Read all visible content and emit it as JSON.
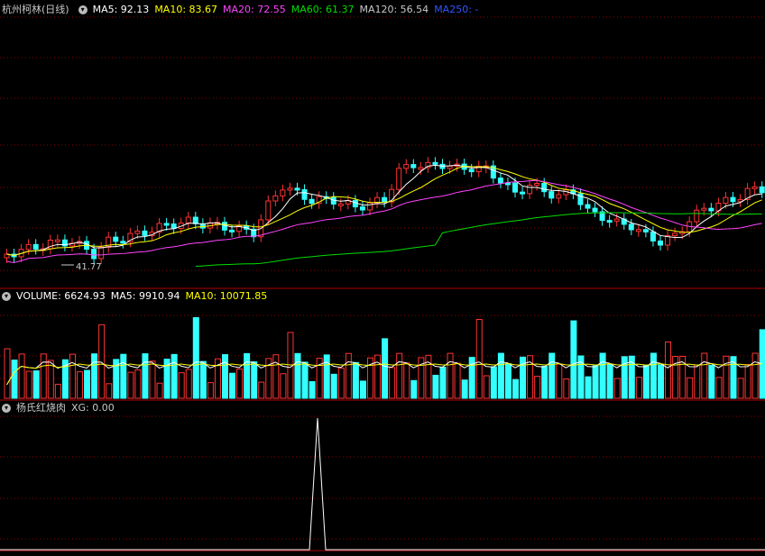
{
  "price_panel": {
    "title": "杭州柯林(日线)",
    "ma": [
      {
        "label": "MA5: 92.13",
        "color": "#ffffff"
      },
      {
        "label": "MA10: 83.67",
        "color": "#ffff00"
      },
      {
        "label": "MA20: 72.55",
        "color": "#ff44ff"
      },
      {
        "label": "MA60: 61.37",
        "color": "#00dd00"
      },
      {
        "label": "MA120: 56.54",
        "color": "#c8c8c8"
      },
      {
        "label": "MA250: -",
        "color": "#3355ff"
      }
    ],
    "low_marker": "41.77"
  },
  "volume_panel": {
    "items": [
      {
        "label": "VOLUME: 6624.93",
        "color": "#ffffff"
      },
      {
        "label": "MA5: 9910.94",
        "color": "#ffffff"
      },
      {
        "label": "MA10: 10071.85",
        "color": "#ffff00"
      }
    ]
  },
  "indicator_panel": {
    "title": "杨氏红烧肉",
    "xg": "XG: 0.00"
  },
  "colors": {
    "up": "#ff3333",
    "down": "#33ffff",
    "grid": "#8b0000",
    "ma5": "#ffffff",
    "ma10": "#ffff00",
    "ma20": "#ff44ff",
    "ma60": "#00dd00"
  },
  "chart_data": [
    {
      "type": "candlestick",
      "title": "杭州柯林(日线)",
      "ohlc_units": "price",
      "annotations": [
        "41.77"
      ]
    },
    {
      "type": "bar",
      "title": "VOLUME",
      "values_summary": {
        "volume": 6624.93,
        "ma5": 9910.94,
        "ma10": 10071.85
      }
    },
    {
      "type": "line",
      "title": "杨氏红烧肉",
      "values_summary": {
        "xg": 0.0
      }
    }
  ]
}
